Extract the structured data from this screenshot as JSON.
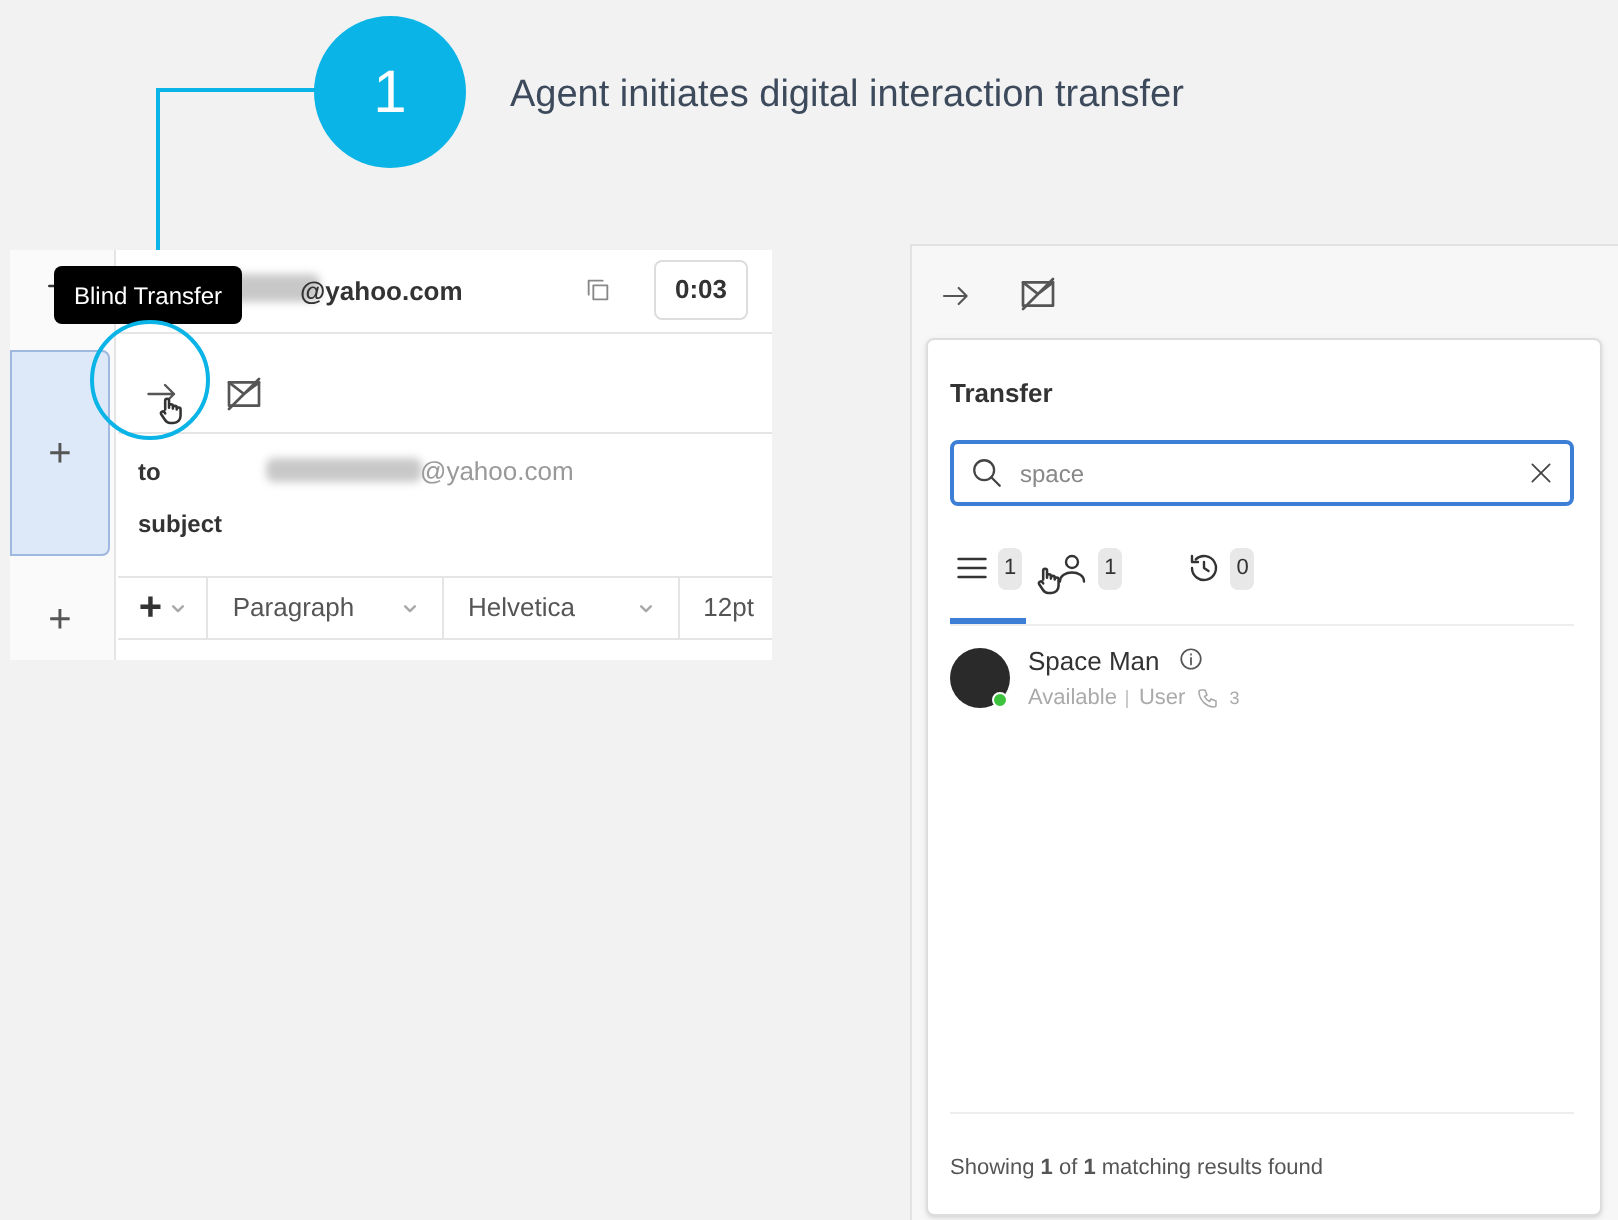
{
  "callout": {
    "number": "1",
    "text": "Agent initiates digital interaction transfer"
  },
  "left_screenshot": {
    "tooltip": "Blind Transfer",
    "header_email": "@yahoo.com",
    "timer": "0:03",
    "sidebar": [
      {
        "label": "+",
        "selected": true
      },
      {
        "label": "+",
        "selected": false
      }
    ],
    "fields": [
      {
        "label": "to",
        "value": "@yahoo.com"
      },
      {
        "label": "subject"
      }
    ],
    "format_toolbar": {
      "insert": "+",
      "dropdowns": [
        "Paragraph",
        "Helvetica"
      ],
      "size": "12pt"
    }
  },
  "right_panel": {
    "title": "Transfer",
    "search": {
      "value": "space"
    },
    "tabs": [
      {
        "kind": "all",
        "count": "1",
        "selected": true
      },
      {
        "kind": "users",
        "count": "1",
        "selected": false
      },
      {
        "kind": "recent",
        "count": "0",
        "selected": false
      }
    ],
    "results": [
      {
        "name": "Space Man",
        "status": "Available",
        "type": "User",
        "extension": "3",
        "online": true
      }
    ],
    "footer": "Showing **1** of **1** matching results found"
  }
}
